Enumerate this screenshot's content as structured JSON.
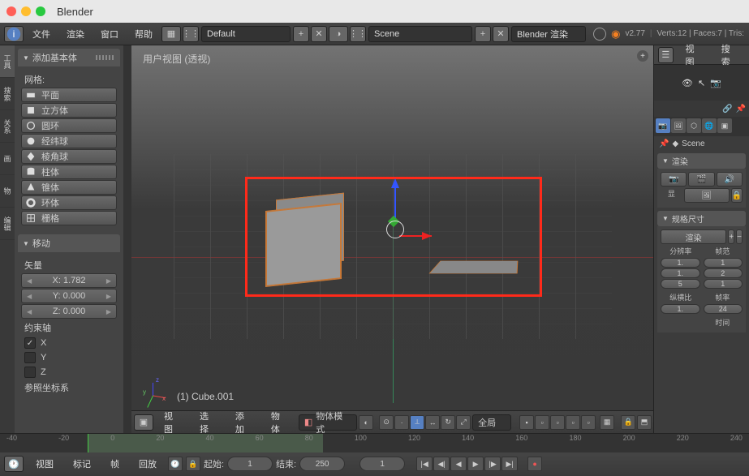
{
  "titlebar": {
    "app_name": "Blender"
  },
  "infobar": {
    "menus": [
      "文件",
      "渲染",
      "窗口",
      "帮助"
    ],
    "layout_field": "Default",
    "scene_field": "Scene",
    "engine": "Blender 渲染",
    "version": "v2.77",
    "stats": "Verts:12 | Faces:7 | Tris:"
  },
  "toolshelf": {
    "tabs": [
      "工具",
      "搜索",
      "关系",
      "画",
      "物",
      "编辑"
    ],
    "add_panel": {
      "title": "添加基本体",
      "sub_label": "网格:",
      "items": [
        "平面",
        "立方体",
        "圆环",
        "经纬球",
        "棱角球",
        "柱体",
        "锥体",
        "环体",
        "栅格"
      ]
    },
    "move_panel": {
      "title": "移动",
      "vector_label": "矢量",
      "x": "1.782",
      "y": "0.000",
      "z": "0.000",
      "constraint_label": "约束轴",
      "axes": [
        "X",
        "Y",
        "Z"
      ],
      "ref_label": "参照坐标系"
    }
  },
  "viewport": {
    "view_label": "用户视图 (透视)",
    "object_label": "(1) Cube.001"
  },
  "v3d_header": {
    "menus": [
      "视图",
      "选择",
      "添加",
      "物体"
    ],
    "mode": "物体模式",
    "orientation": "全局"
  },
  "timeline": {
    "ticks": [
      "-40",
      "-20",
      "0",
      "20",
      "40",
      "60",
      "80",
      "100",
      "120",
      "140",
      "160",
      "180",
      "200",
      "220",
      "240"
    ],
    "menus": [
      "视图",
      "标记",
      "帧",
      "回放"
    ],
    "start_label": "起始:",
    "start_val": "1",
    "end_label": "结束:",
    "end_val": "250",
    "current_val": "1"
  },
  "outliner": {
    "menus": [
      "视图",
      "搜索"
    ]
  },
  "properties": {
    "scene_crumb": "Scene",
    "render_panel": "渲染",
    "display_row": "显",
    "dim_panel": "规格尺寸",
    "preset": "渲染",
    "res_label": "分辨率",
    "frange_label": "帧范",
    "aspect_label": "纵横比",
    "frate_label": "帧率",
    "time_label": "时间",
    "res_vals": [
      "1.",
      "1.",
      "5"
    ],
    "fr_vals": [
      "1",
      "2",
      "1"
    ],
    "aspect_val": "1.",
    "frate_val": "24"
  }
}
